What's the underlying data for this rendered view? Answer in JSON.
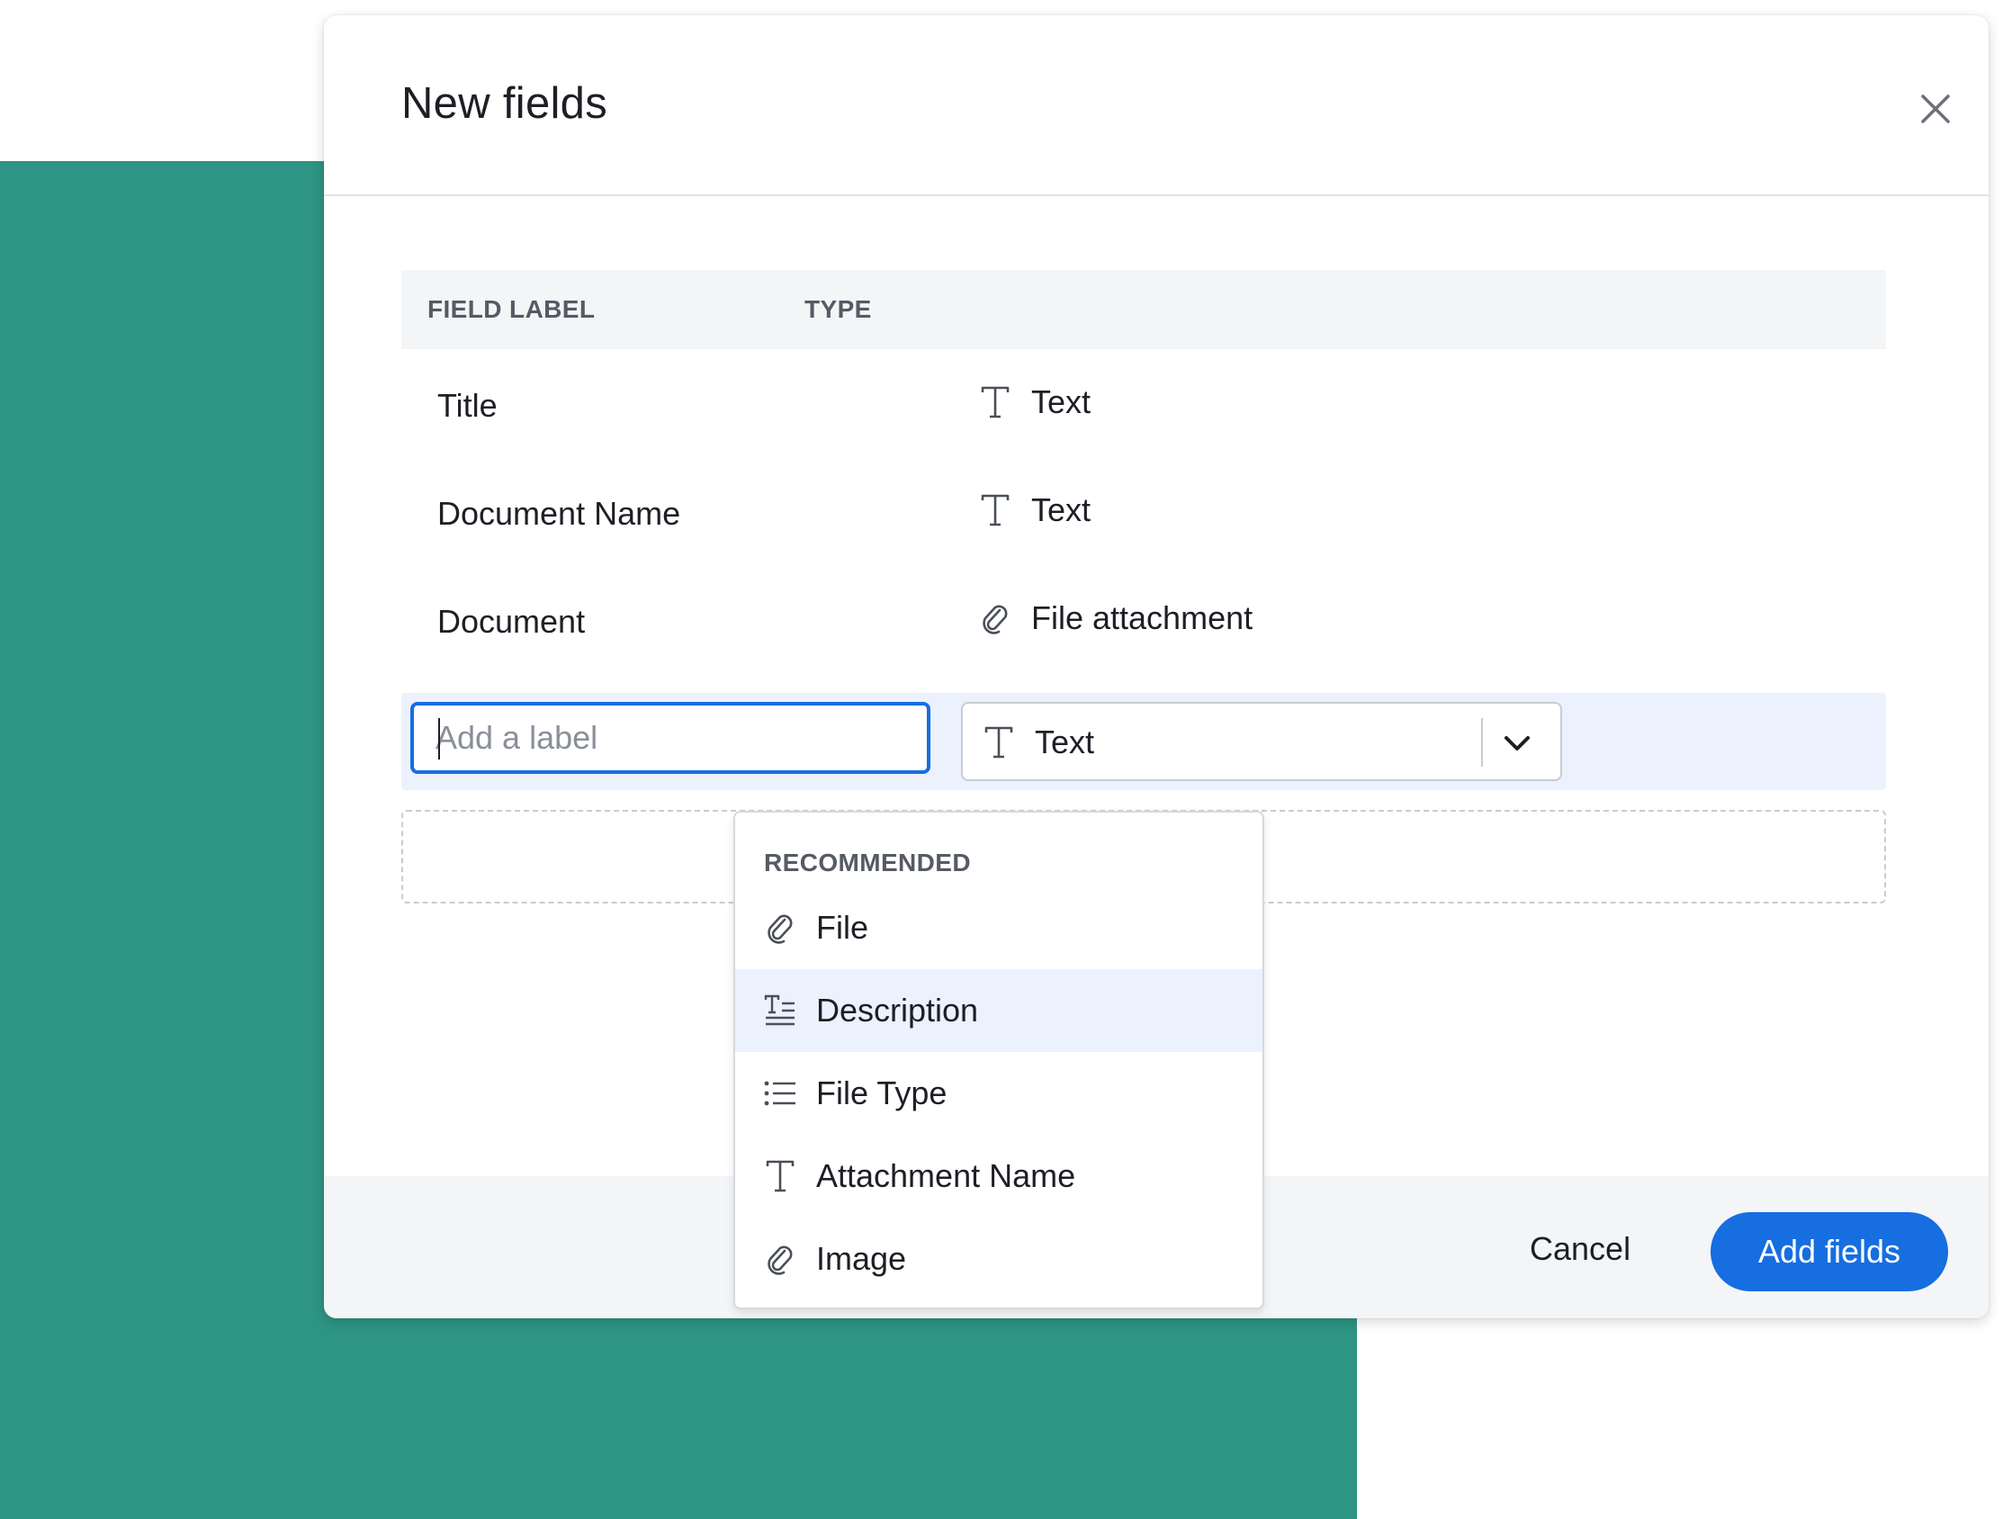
{
  "modal": {
    "title": "New fields",
    "close_icon": "close-icon"
  },
  "table": {
    "headers": {
      "label": "FIELD LABEL",
      "type": "TYPE"
    },
    "rows": [
      {
        "label": "Title",
        "type": "Text",
        "icon": "text-type-icon"
      },
      {
        "label": "Document Name",
        "type": "Text",
        "icon": "text-type-icon"
      },
      {
        "label": "Document",
        "type": "File attachment",
        "icon": "paperclip-icon"
      }
    ]
  },
  "new_field": {
    "label_value": "",
    "label_placeholder": "Add a label",
    "type_selected": "Text",
    "type_icon": "text-type-icon"
  },
  "dropdown": {
    "header": "RECOMMENDED",
    "items": [
      {
        "label": "File",
        "icon": "paperclip-icon"
      },
      {
        "label": "Description",
        "icon": "long-text-icon",
        "highlighted": true
      },
      {
        "label": "File Type",
        "icon": "list-icon"
      },
      {
        "label": "Attachment Name",
        "icon": "text-type-icon"
      },
      {
        "label": "Image",
        "icon": "paperclip-icon"
      }
    ]
  },
  "footer": {
    "cancel_label": "Cancel",
    "add_label": "Add fields"
  },
  "colors": {
    "background_accent": "#2e9483",
    "primary": "#166ee1",
    "highlight": "#ebf1fd",
    "header_bg": "#f4f5f7",
    "text": "#1d1f25",
    "muted": "#555a64"
  }
}
